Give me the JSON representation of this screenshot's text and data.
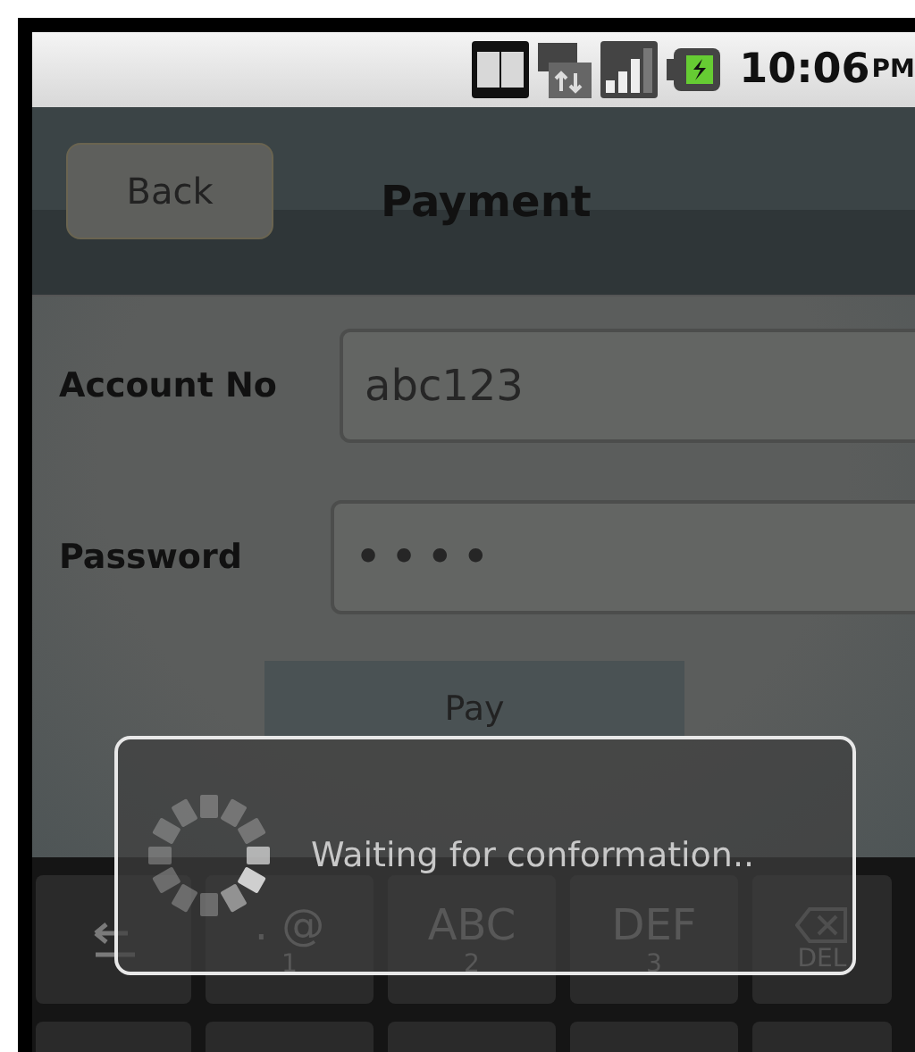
{
  "status_bar": {
    "time": "10:06",
    "time_suffix": "PM"
  },
  "header": {
    "back_button": "Back",
    "title": "Payment"
  },
  "form": {
    "fields": [
      {
        "label": "Account No",
        "value": "abc123",
        "kind": "text"
      },
      {
        "label": "Password",
        "value": "••••",
        "kind": "password"
      }
    ],
    "submit_button": "Pay"
  },
  "keyboard": {
    "rows": [
      [
        {
          "kind": "icon"
        },
        {
          "kind": "key",
          "label": ". @",
          "sub": "1"
        },
        {
          "kind": "key",
          "label": "ABC",
          "sub": "2"
        },
        {
          "kind": "key",
          "label": "DEF",
          "sub": "3"
        },
        {
          "kind": "delete",
          "label": "DEL"
        }
      ],
      [
        {
          "kind": "blank"
        },
        {
          "kind": "blank"
        },
        {
          "kind": "blank"
        },
        {
          "kind": "blank"
        },
        {
          "kind": "blank"
        }
      ]
    ]
  },
  "dialog": {
    "message": "Waiting for conformation.."
  }
}
